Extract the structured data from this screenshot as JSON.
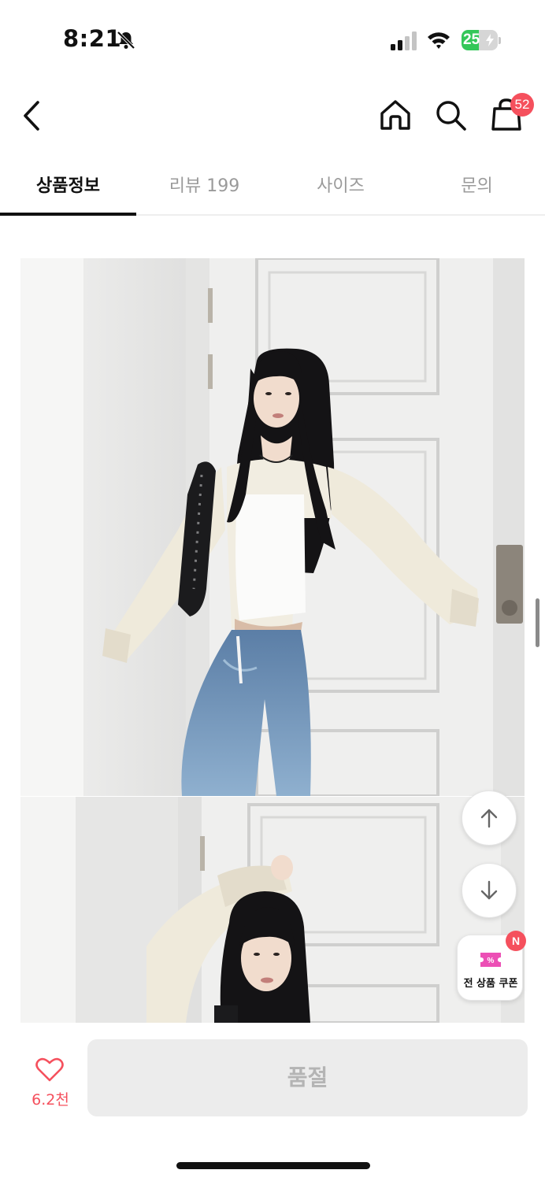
{
  "status_bar": {
    "time": "8:21",
    "battery_level": "25",
    "battery_percent": 25,
    "icons": [
      "bell-slash-icon",
      "signal-icon",
      "wifi-icon",
      "battery-charging-icon"
    ]
  },
  "nav": {
    "icons": [
      "chevron-left-icon",
      "home-icon",
      "search-icon",
      "shopping-bag-icon"
    ],
    "cart_count": "52"
  },
  "tabs": [
    {
      "label": "상품정보",
      "active": true
    },
    {
      "label": "리뷰 199",
      "active": false
    },
    {
      "label": "사이즈",
      "active": false
    },
    {
      "label": "문의",
      "active": false
    }
  ],
  "floating": {
    "icons": [
      "arrow-up-icon",
      "arrow-down-icon",
      "coupon-ticket-icon"
    ],
    "coupon_label": "전 상품 쿠폰",
    "coupon_badge": "N"
  },
  "bottom_bar": {
    "like_icon": "heart-outline-icon",
    "like_count": "6.2천",
    "purchase_label": "품절"
  },
  "colors": {
    "accent": "#f5505d",
    "battery_green": "#34c759",
    "coupon_pink": "#ec4fb5",
    "tab_active": "#111111",
    "tab_inactive": "#9a9a9a",
    "disabled_button": "#ececec"
  }
}
